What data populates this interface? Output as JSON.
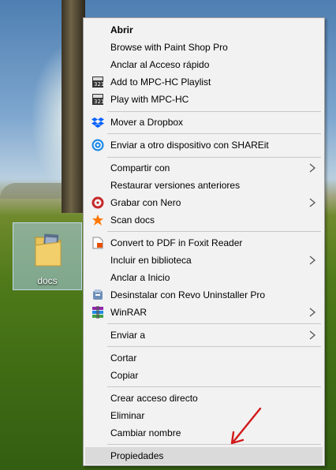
{
  "desktop": {
    "icon_label": "docs"
  },
  "context_menu": {
    "items": [
      {
        "label": "Abrir"
      },
      {
        "label": "Browse with Paint Shop Pro"
      },
      {
        "label": "Anclar al Acceso rápido"
      },
      {
        "label": "Add to MPC-HC Playlist",
        "icon": "mpc-hc-icon"
      },
      {
        "label": "Play with MPC-HC",
        "icon": "mpc-hc-icon"
      },
      {
        "label": "Mover a Dropbox",
        "icon": "dropbox-icon"
      },
      {
        "label": "Enviar a otro dispositivo con SHAREit",
        "icon": "shareit-icon"
      },
      {
        "label": "Compartir con"
      },
      {
        "label": "Restaurar versiones anteriores"
      },
      {
        "label": "Grabar con Nero",
        "icon": "nero-icon"
      },
      {
        "label": "Scan docs",
        "icon": "avast-icon"
      },
      {
        "label": "Convert to PDF in Foxit Reader",
        "icon": "foxit-icon"
      },
      {
        "label": "Incluir en biblioteca"
      },
      {
        "label": "Anclar a Inicio"
      },
      {
        "label": "Desinstalar con Revo Uninstaller Pro",
        "icon": "revo-icon"
      },
      {
        "label": "WinRAR",
        "icon": "winrar-icon"
      },
      {
        "label": "Enviar a"
      },
      {
        "label": "Cortar"
      },
      {
        "label": "Copiar"
      },
      {
        "label": "Crear acceso directo"
      },
      {
        "label": "Eliminar"
      },
      {
        "label": "Cambiar nombre"
      },
      {
        "label": "Propiedades"
      }
    ]
  },
  "colors": {
    "menu_background": "#f2f2f2",
    "highlight": "#dadada",
    "annotation_arrow": "#d0191a",
    "dropbox_blue": "#0061fe",
    "shareit_blue": "#1e88e5"
  }
}
